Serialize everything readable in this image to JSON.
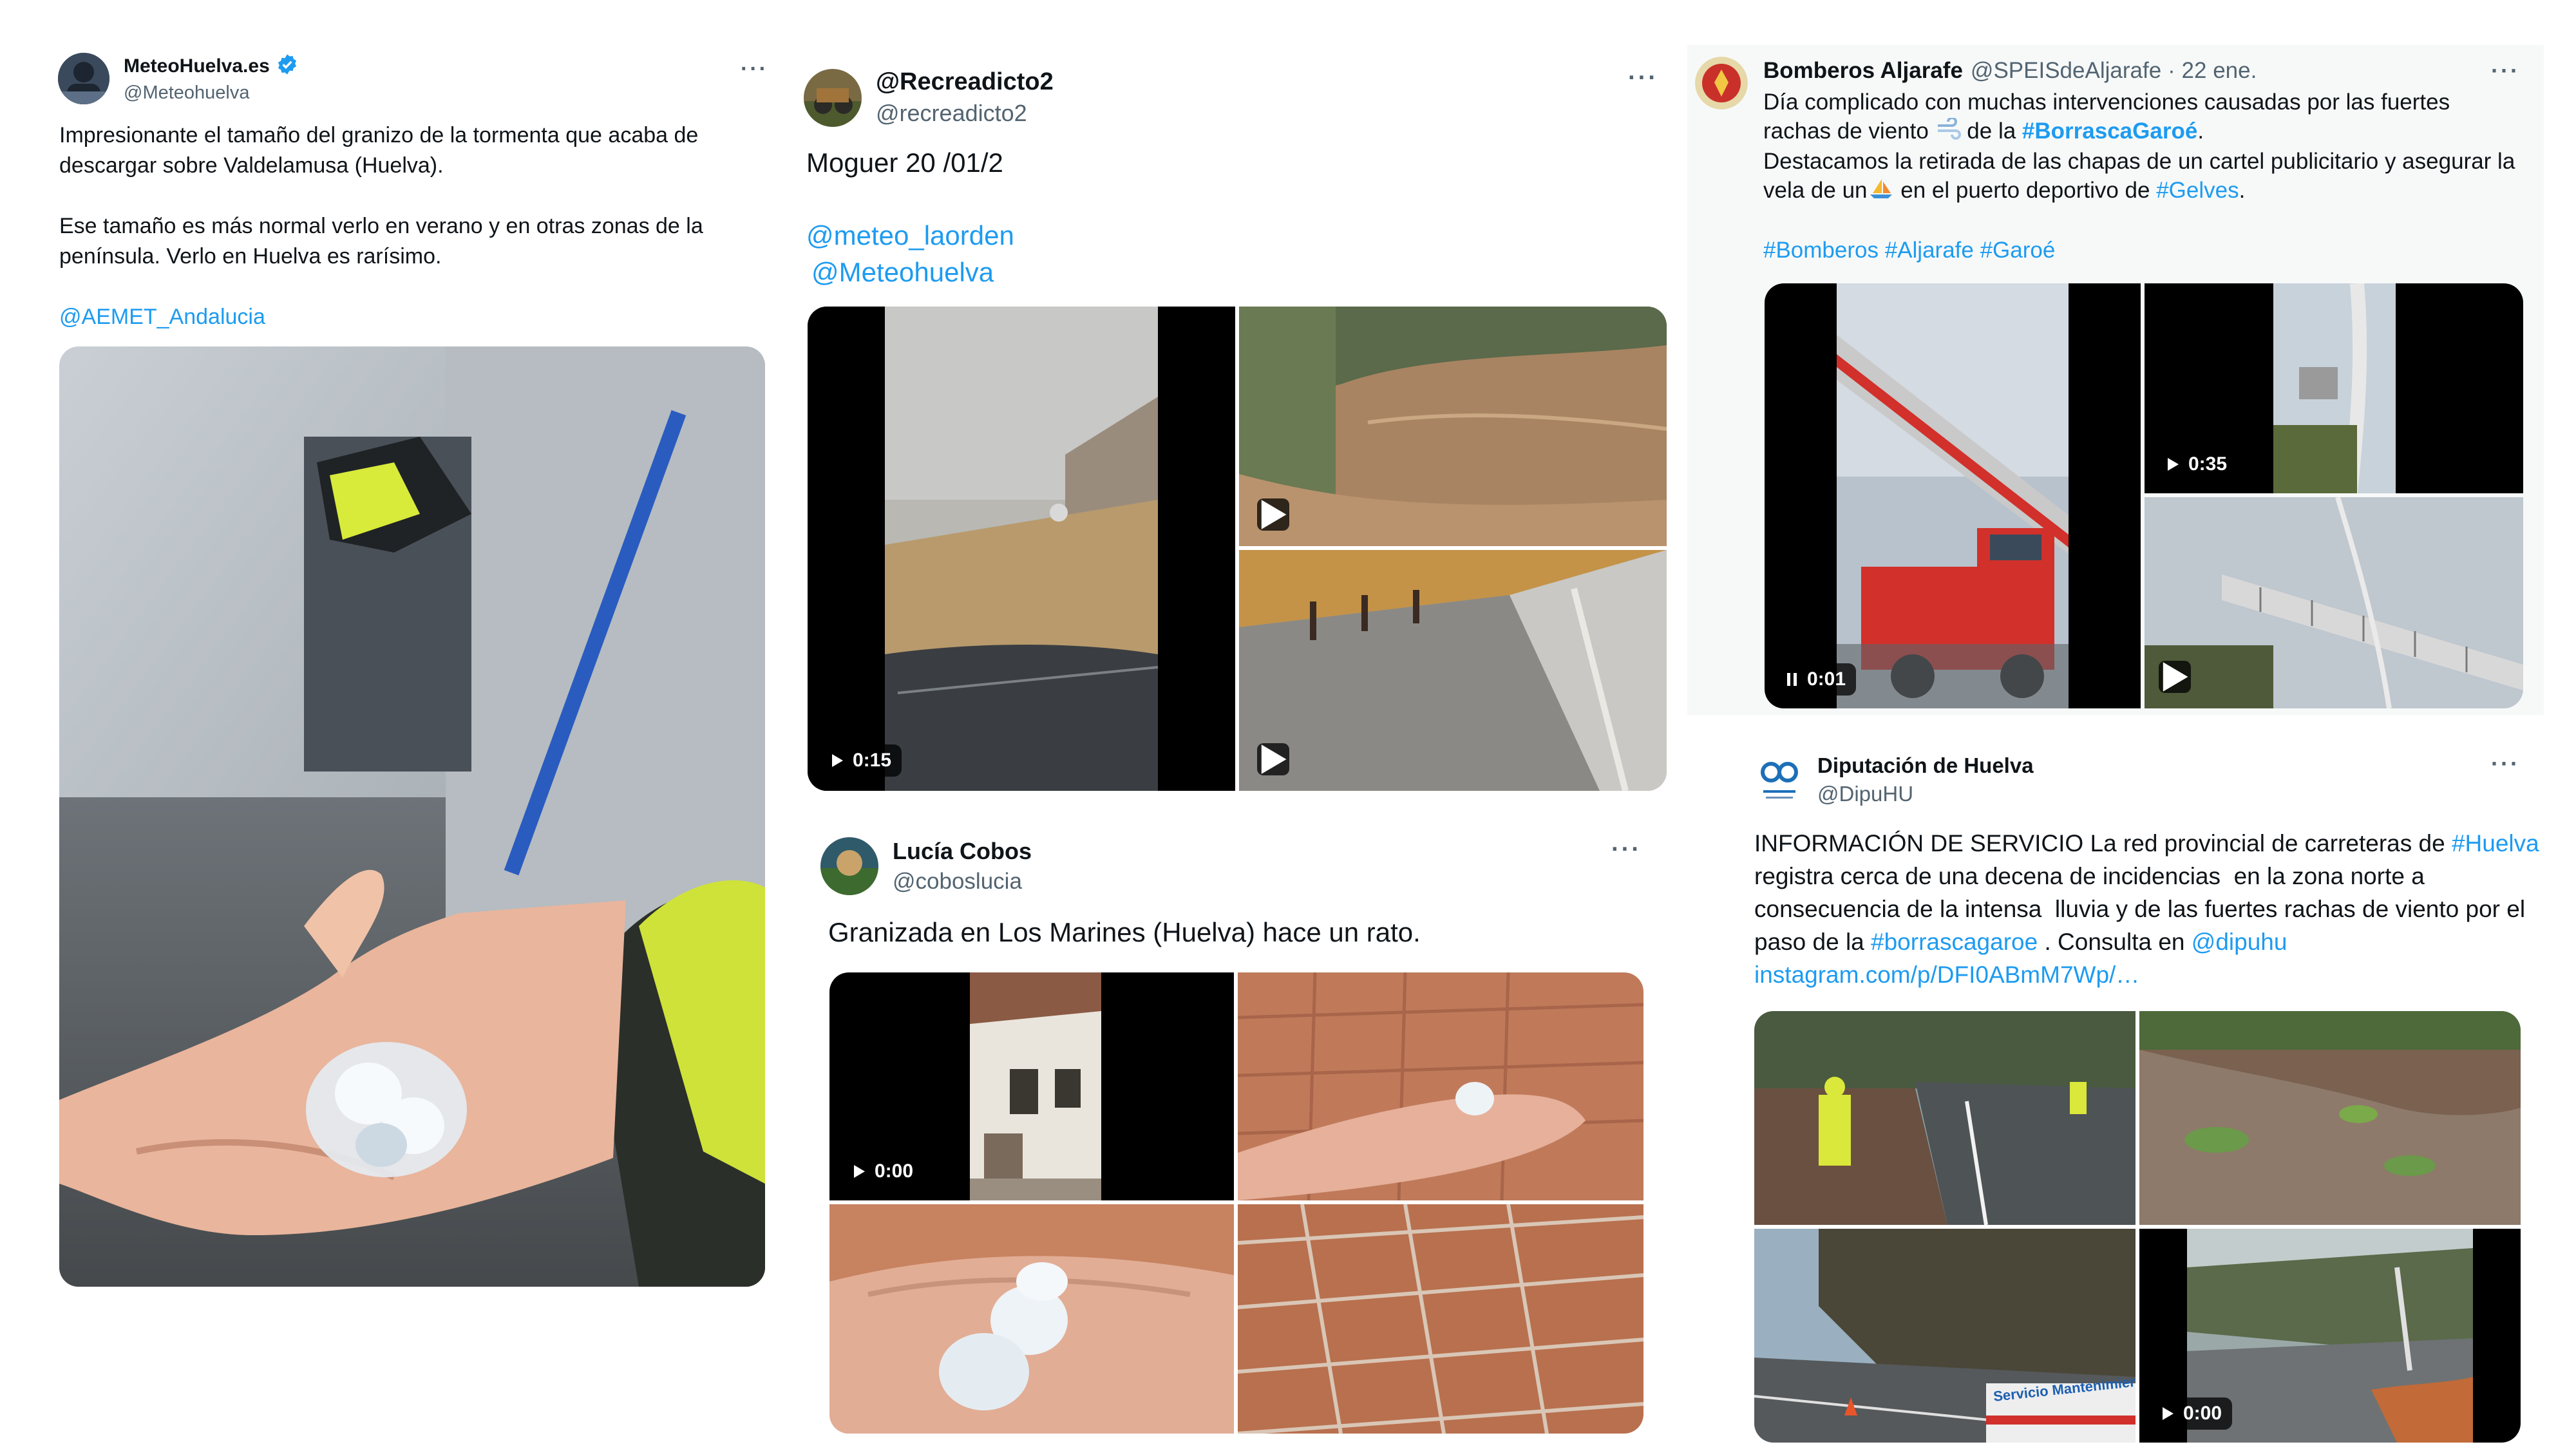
{
  "tweets": [
    {
      "display_name": "MeteoHuelva.es",
      "handle": "@Meteohuelva",
      "verified": true,
      "more_label": "···",
      "text_lines": [
        "Impresionante el tamaño del granizo de la tormenta que acaba de",
        "descargar sobre Valdelamusa (Huelva).",
        "Ese tamaño es más normal verlo en verano y en otras zonas de la",
        "península. Verlo en Huelva es rarísimo."
      ],
      "mention": "@AEMET_Andalucia",
      "media": [
        {
          "kind": "photo",
          "icon": "hailstone-in-hand-photo"
        }
      ]
    },
    {
      "display_name": "@Recreadicto2",
      "handle": "@recreadicto2",
      "more_label": "···",
      "text_lines": [
        "Moguer 20 /01/2"
      ],
      "mentions": [
        "@meteo_laorden",
        "@Meteohuelva"
      ],
      "media": [
        {
          "kind": "video",
          "duration": "0:15",
          "icon": "flooded-road-video"
        },
        {
          "kind": "video",
          "icon": "muddy-stream-video"
        },
        {
          "kind": "video",
          "icon": "wet-street-video"
        }
      ]
    },
    {
      "display_name": "Lucía Cobos",
      "handle": "@coboslucia",
      "more_label": "···",
      "text_lines": [
        "Granizada en Los Marines (Huelva) hace un rato."
      ],
      "media": [
        {
          "kind": "video",
          "duration": "0:00",
          "icon": "white-house-video"
        },
        {
          "kind": "photo",
          "icon": "hail-in-hand-on-tiles-photo"
        },
        {
          "kind": "photo",
          "icon": "hail-closeup-in-hand-photo"
        },
        {
          "kind": "photo",
          "icon": "hail-on-tiles-photo"
        }
      ]
    },
    {
      "display_name": "Bomberos Aljarafe",
      "handle": "@SPEISdeAljarafe",
      "date": "· 22 ene.",
      "more_label": "···",
      "text_line1": "Día complicado con muchas intervenciones causadas por las fuertes",
      "text_line2_a": "rachas de viento ",
      "text_line2_b": " de la ",
      "hashtag_borrasca": "#BorrascaGaroé",
      "text_line2_c": ".",
      "text_line3": "Destacamos la retirada de las chapas de un cartel publicitario y asegurar la",
      "text_line4_a": "vela de un",
      "text_line4_b": " en el puerto deportivo de ",
      "hashtag_gelves": "#Gelves",
      "text_line4_c": ".",
      "hashtags": [
        "#Bomberos",
        "#Aljarafe",
        "#Garoé"
      ],
      "media": [
        {
          "kind": "video",
          "duration": "0:01",
          "state": "paused-icon",
          "icon": "fire-truck-ladder-video"
        },
        {
          "kind": "video",
          "duration": "0:35",
          "icon": "sailboat-mast-video"
        },
        {
          "kind": "video",
          "icon": "ladder-platform-video"
        }
      ]
    },
    {
      "display_name": "Diputación de Huelva",
      "handle": "@DipuHU",
      "more_label": "···",
      "text_line1_a": "INFORMACIÓN DE SERVICIO La red provincial de carreteras de ",
      "hashtag_huelva": "#Huelva",
      "text_line2": "registra cerca de una decena de incidencias  en la zona norte a",
      "text_line3": "consecuencia de la intensa  lluvia y de las fuertes rachas de viento por el",
      "text_line4_a": "paso de la ",
      "hashtag_borrasca": "#borrascagaroe",
      "text_line4_b": " . Consulta en ",
      "mention": "@dipuhu",
      "url": "instagram.com/p/DFI0ABmM7Wp/…",
      "media": [
        {
          "kind": "photo",
          "icon": "workers-on-road-photo"
        },
        {
          "kind": "photo",
          "icon": "landslide-mud-photo"
        },
        {
          "kind": "photo",
          "icon": "rockfall-road-photo",
          "sign_text": "Servicio Mantenimiento"
        },
        {
          "kind": "video",
          "duration": "0:00",
          "icon": "flooded-forest-road-video"
        }
      ]
    }
  ],
  "colors": {
    "link": "#1d9bf0",
    "text": "#0f1419",
    "secondary": "#536471",
    "card_grey": "#f7f9f9"
  }
}
